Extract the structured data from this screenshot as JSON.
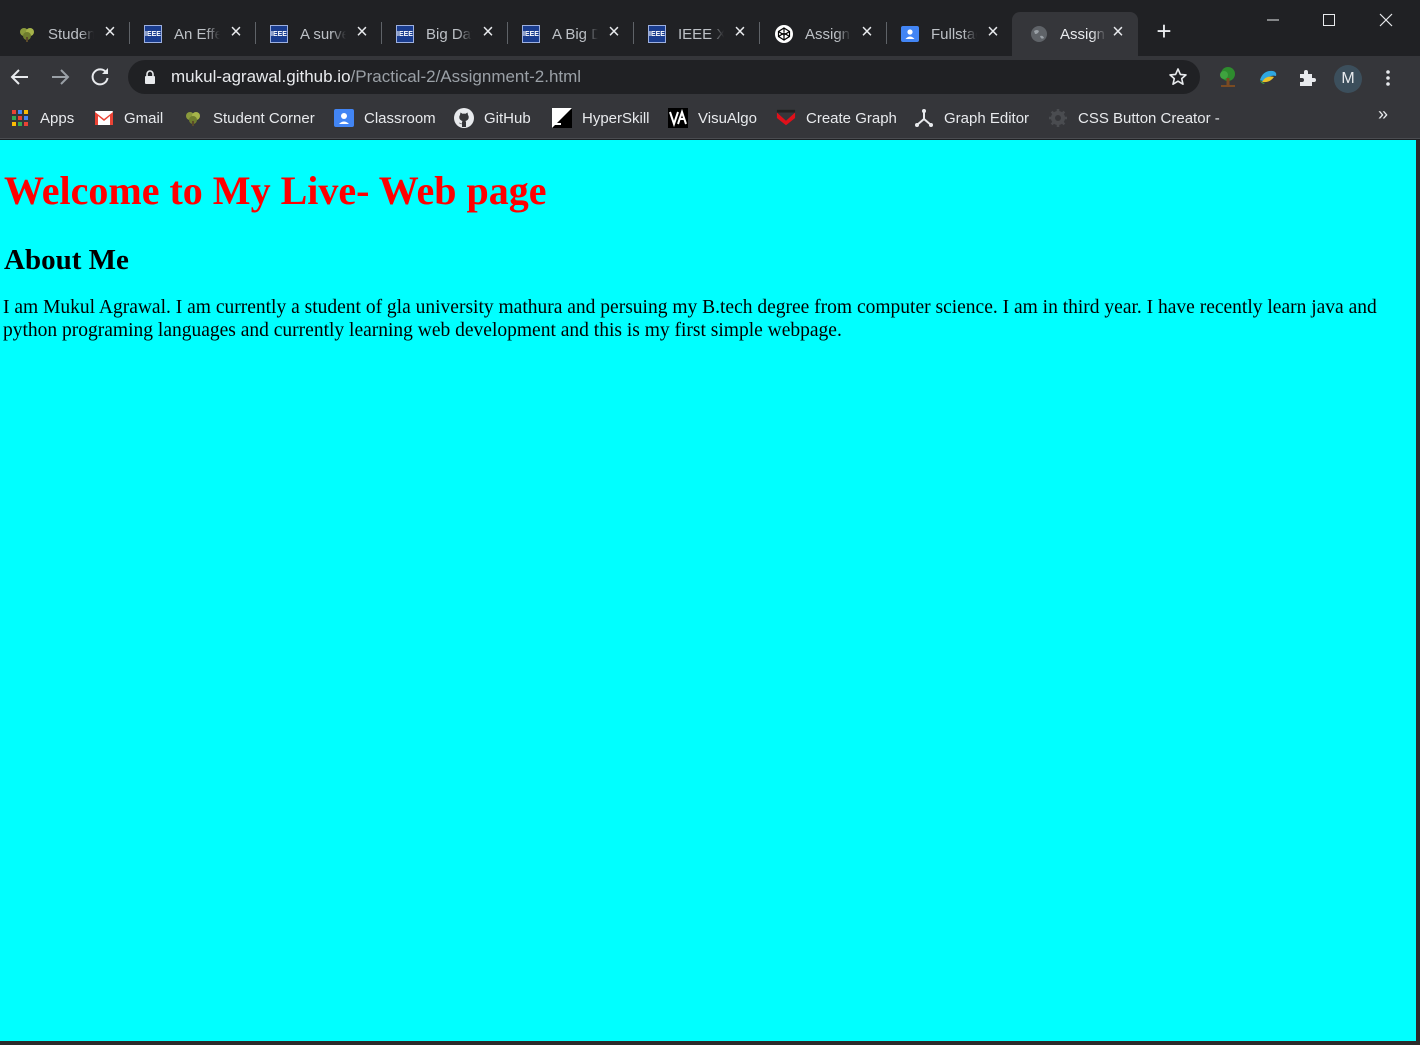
{
  "tabs": [
    {
      "title": "Student Corner",
      "icon": "student-corner-icon"
    },
    {
      "title": "An Effective",
      "icon": "ieee-icon"
    },
    {
      "title": "A survey",
      "icon": "ieee-icon"
    },
    {
      "title": "Big Data",
      "icon": "ieee-icon"
    },
    {
      "title": "A Big Data",
      "icon": "ieee-icon"
    },
    {
      "title": "IEEE Xplore",
      "icon": "ieee-icon"
    },
    {
      "title": "Assignment",
      "icon": "codepen-icon"
    },
    {
      "title": "Fullstack",
      "icon": "classroom-icon"
    },
    {
      "title": "Assignment",
      "icon": "globe-icon",
      "active": true
    }
  ],
  "ieee_text": "IEEE",
  "address": {
    "host": "mukul-agrawal.github.io",
    "path": "/Practical-2/Assignment-2.html"
  },
  "profile_initial": "M",
  "bookmarks": [
    {
      "label": "Apps",
      "icon": "apps-grid-icon"
    },
    {
      "label": "Gmail",
      "icon": "gmail-icon"
    },
    {
      "label": "Student Corner",
      "icon": "student-corner-icon"
    },
    {
      "label": "Classroom",
      "icon": "classroom-icon"
    },
    {
      "label": "GitHub",
      "icon": "github-icon"
    },
    {
      "label": "HyperSkill",
      "icon": "hyperskill-icon"
    },
    {
      "label": "VisuAlgo",
      "icon": "visualgo-icon"
    },
    {
      "label": "Create Graph",
      "icon": "create-graph-icon"
    },
    {
      "label": "Graph Editor",
      "icon": "graph-editor-icon"
    },
    {
      "label": "CSS Button Creator -",
      "icon": "css-button-creator-icon"
    }
  ],
  "bookmarks_overflow": "»",
  "page": {
    "heading": "Welcome to My Live- Web page",
    "subheading": "About Me",
    "paragraph": "I am Mukul Agrawal. I am currently a student of gla university mathura and persuing my B.tech degree from computer science. I am in third year. I have recently learn java and python programing languages and currently learning web development and this is my first simple webpage."
  },
  "colors": {
    "page_background": "#00ffff",
    "heading": "#ff0000",
    "browser_frame": "#202124",
    "toolbar": "#35363a"
  }
}
